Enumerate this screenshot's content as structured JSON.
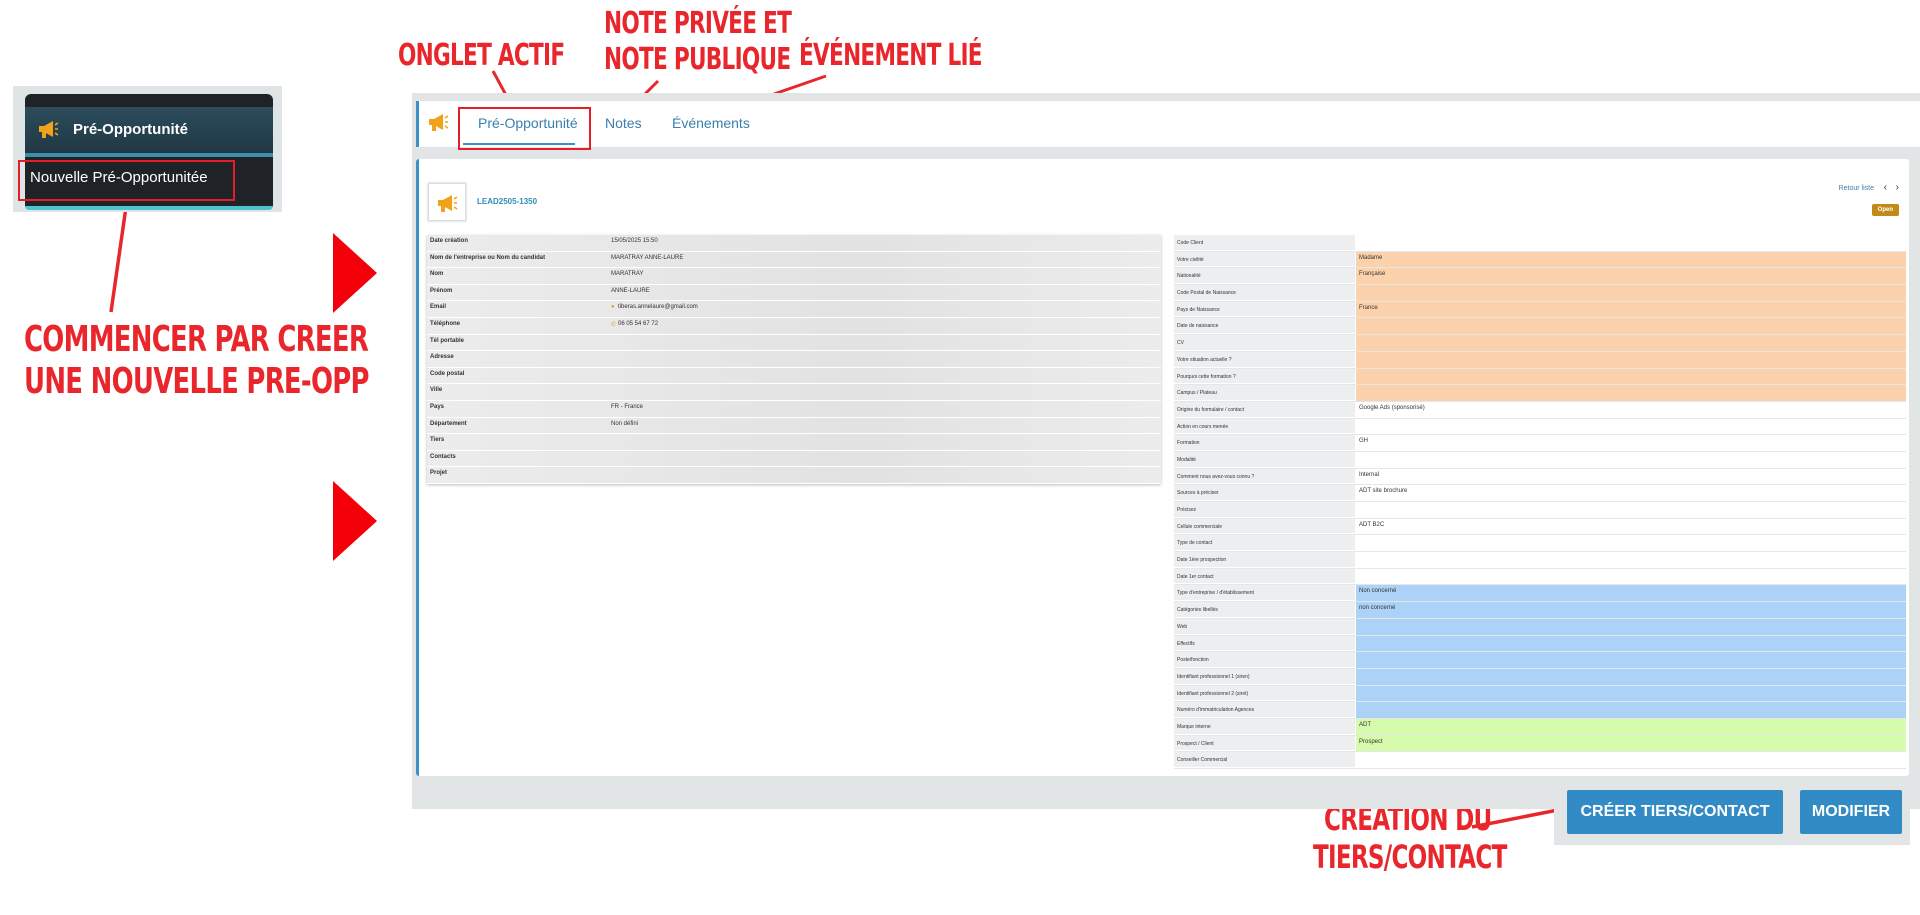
{
  "annotations": {
    "onglet_actif": "ONGLET ACTIF",
    "note_line1": "NOTE PRIVÉE ET",
    "note_line2": "NOTE PUBLIQUE",
    "evenement_lie": "ÉVÉNEMENT LIÉ",
    "commencer_line1": "COMMENCER PAR CREER",
    "commencer_line2": "UNE NOUVELLE PRE-OPP",
    "creation_line1": "CRÉATION DU",
    "creation_line2": "TIERS/CONTACT"
  },
  "sidebar": {
    "title": "Pré-Opportunité",
    "item": "Nouvelle Pré-Opportunitée",
    "icon": "megaphone-icon"
  },
  "tabs": [
    {
      "label": "Pré-Opportunité",
      "active": true
    },
    {
      "label": "Notes",
      "active": false
    },
    {
      "label": "Événements",
      "active": false
    }
  ],
  "record": {
    "ref": "LEAD2505-1350",
    "retour_liste": "Retour liste",
    "status": "Open"
  },
  "left_fields": [
    {
      "label": "Date création",
      "value": "15/05/2025 15:50"
    },
    {
      "label": "Nom de l'entreprise ou Nom du candidat",
      "value": "MARATRAY ANNE-LAURE"
    },
    {
      "label": "Nom",
      "value": "MARATRAY"
    },
    {
      "label": "Prénom",
      "value": "ANNE-LAURE"
    },
    {
      "label": "Email",
      "value": "tiberas.annelaure@gmail.com"
    },
    {
      "label": "Téléphone",
      "value": "06 05 54 67 72"
    },
    {
      "label": "Tél portable",
      "value": ""
    },
    {
      "label": "Adresse",
      "value": ""
    },
    {
      "label": "Code postal",
      "value": ""
    },
    {
      "label": "Ville",
      "value": ""
    },
    {
      "label": "Pays",
      "value": "FR - France"
    },
    {
      "label": "Département",
      "value": "Non défini"
    },
    {
      "label": "Tiers",
      "value": ""
    },
    {
      "label": "Contacts",
      "value": ""
    },
    {
      "label": "Projet",
      "value": ""
    }
  ],
  "right_fields": [
    {
      "label": "Code Client",
      "value": "",
      "color": "#ffffff"
    },
    {
      "label": "Votre civilité",
      "value": "Madame",
      "color": "#fbd2ac"
    },
    {
      "label": "Nationalité",
      "value": "Française",
      "color": "#fbd2ac"
    },
    {
      "label": "Code Postal de Naissance",
      "value": "",
      "color": "#fbd2ac"
    },
    {
      "label": "Pays de Naissance",
      "value": "France",
      "color": "#fbd2ac"
    },
    {
      "label": "Date de naissance",
      "value": "",
      "color": "#fbd2ac"
    },
    {
      "label": "CV",
      "value": "",
      "color": "#fbd2ac"
    },
    {
      "label": "Votre situation actuelle ?",
      "value": "",
      "color": "#fbd2ac"
    },
    {
      "label": "Pourquoi cette formation ?",
      "value": "",
      "color": "#fbd2ac"
    },
    {
      "label": "Campus / Plateau",
      "value": "",
      "color": "#fbd2ac"
    },
    {
      "label": "Origine du formulaire / contact",
      "value": "Google Ads (sponsorisé)",
      "color": "#ffffff"
    },
    {
      "label": "Action en cours menée",
      "value": "",
      "color": "#ffffff"
    },
    {
      "label": "Formation",
      "value": "GH",
      "color": "#ffffff"
    },
    {
      "label": "Modalité",
      "value": "",
      "color": "#ffffff"
    },
    {
      "label": "Comment nous avez-vous connu ?",
      "value": "Internal",
      "color": "#ffffff"
    },
    {
      "label": "Sources à préciser",
      "value": "ADT site brochure",
      "color": "#ffffff"
    },
    {
      "label": "Précisez",
      "value": "",
      "color": "#ffffff"
    },
    {
      "label": "Cellule commerciale",
      "value": "ADT B2C",
      "color": "#ffffff"
    },
    {
      "label": "Type de contact",
      "value": "",
      "color": "#ffffff"
    },
    {
      "label": "Date 1ère prospection",
      "value": "",
      "color": "#ffffff"
    },
    {
      "label": "Date 1er contact",
      "value": "",
      "color": "#ffffff"
    },
    {
      "label": "Type d'entreprise / d'établissement",
      "value": "Non concerné",
      "color": "#acd2f8"
    },
    {
      "label": "Catégories libellés",
      "value": "non concerné",
      "color": "#acd2f8"
    },
    {
      "label": "Web",
      "value": "",
      "color": "#acd2f8"
    },
    {
      "label": "Effectifs",
      "value": "",
      "color": "#acd2f8"
    },
    {
      "label": "Poste/fonction",
      "value": "",
      "color": "#acd2f8"
    },
    {
      "label": "Identifiant professionnel 1 (siren)",
      "value": "",
      "color": "#acd2f8"
    },
    {
      "label": "Identifiant professionnel 2 (siret)",
      "value": "",
      "color": "#acd2f8"
    },
    {
      "label": "Numéro d'immatriculation Agences",
      "value": "",
      "color": "#acd2f8"
    },
    {
      "label": "Marque interne",
      "value": "ADT",
      "color": "#d6fbac"
    },
    {
      "label": "Prospect / Client",
      "value": "Prospect",
      "color": "#d6fbac"
    },
    {
      "label": "Conseiller Commercial",
      "value": "",
      "color": "#ffffff"
    }
  ],
  "buttons": {
    "create": "CRÉER TIERS/CONTACT",
    "modify": "MODIFIER"
  },
  "colors": {
    "annotation_red": "#e8262b",
    "accent_blue": "#338bc5",
    "status_gold": "#c28b19"
  }
}
